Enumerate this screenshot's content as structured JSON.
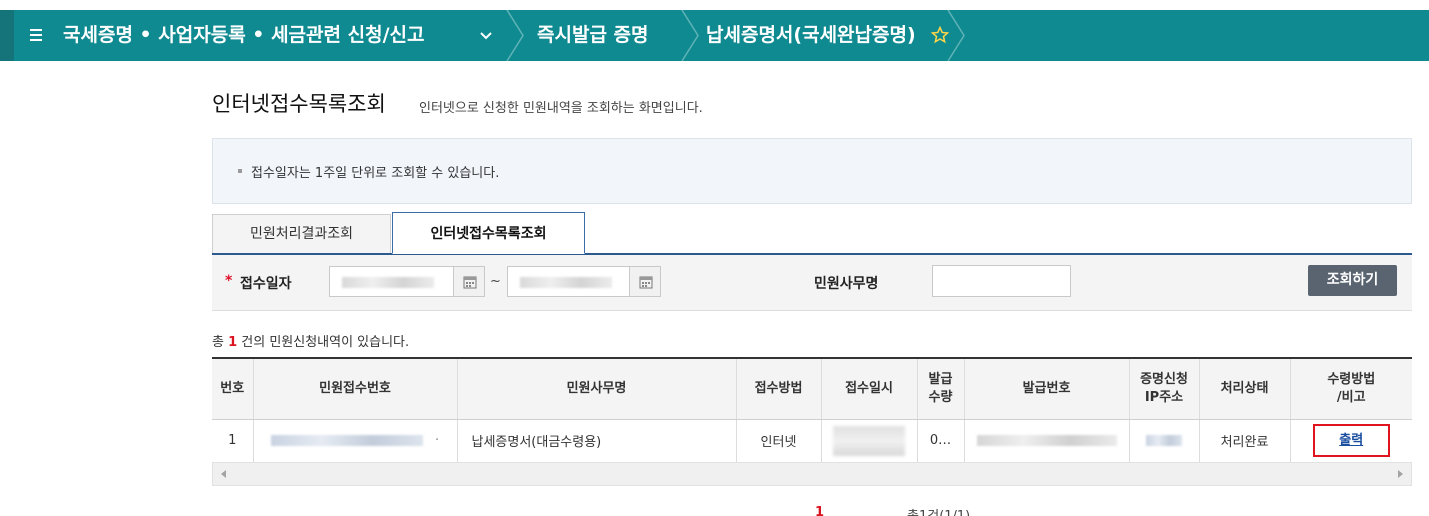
{
  "nav": {
    "menu_title": "국세증명 • 사업자등록 • 세금관련 신청/신고",
    "crumb_1": "즉시발급 증명",
    "crumb_2": "납세증명서(국세완납증명)"
  },
  "page": {
    "title": "인터넷접수목록조회",
    "description": "인터넷으로 신청한 민원내역을 조회하는 화면입니다."
  },
  "notice": {
    "text": "접수일자는 1주일 단위로 조회할 수 있습니다."
  },
  "tabs": [
    {
      "label": "민원처리결과조회",
      "active": false
    },
    {
      "label": "인터넷접수목록조회",
      "active": true
    }
  ],
  "search": {
    "required_mark": "*",
    "date_label": "접수일자",
    "date_separator": "~",
    "name_label": "민원사무명",
    "name_value": "",
    "button_label": "조회하기"
  },
  "result": {
    "prefix": "총 ",
    "count": "1",
    "suffix": " 건의 민원신청내역이 있습니다."
  },
  "table": {
    "headers": [
      "번호",
      "민원접수번호",
      "민원사무명",
      "접수방법",
      "접수일시",
      "발급\n수량",
      "발급번호",
      "증명신청\nIP주소",
      "처리상태",
      "수령방법\n/비고"
    ],
    "rows": [
      {
        "no": "1",
        "receipt_tail": "·",
        "service_name": "납세증명서(대금수령용)",
        "method": "인터넷",
        "quantity": "0…",
        "status": "처리완료",
        "action": "출력"
      }
    ]
  },
  "pagination": {
    "current": "1",
    "total": "총1건(1/1)"
  },
  "colors": {
    "nav_bg": "#0e8a90",
    "accent_red": "#e0141f",
    "link_blue": "#1a4fa0",
    "button_gray": "#5a6470"
  }
}
